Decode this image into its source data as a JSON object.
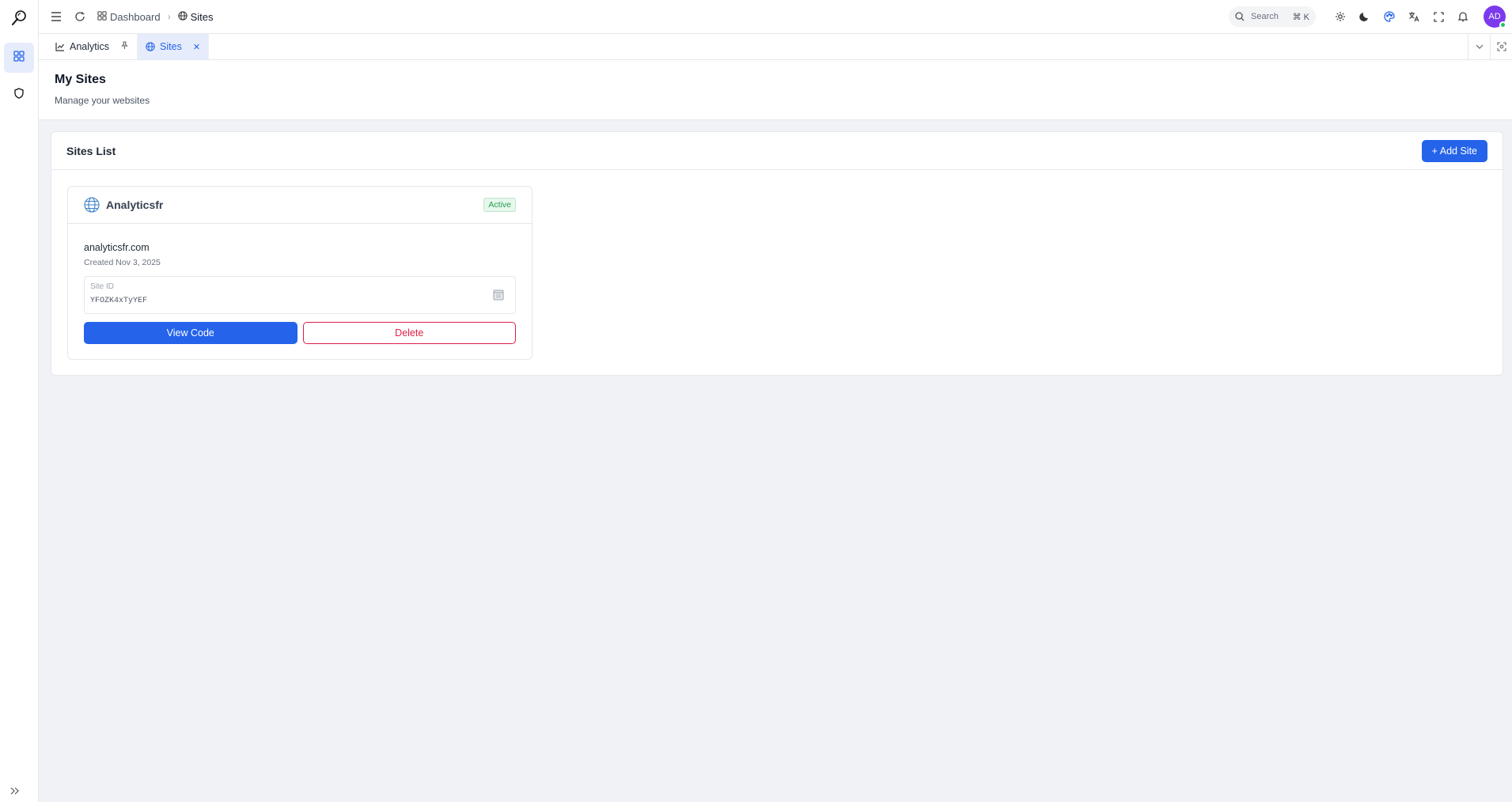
{
  "header": {
    "breadcrumb": [
      {
        "label": "Dashboard",
        "icon": "dashboard-grid-icon"
      },
      {
        "label": "Sites",
        "icon": "globe-icon"
      }
    ],
    "search": {
      "placeholder": "Search",
      "shortcut": "⌘ K"
    },
    "avatar_initials": "AD",
    "icons": [
      "menu-icon",
      "refresh-icon",
      "settings-icon",
      "dark-mode-icon",
      "theme-palette-icon",
      "translate-icon",
      "fullscreen-icon",
      "notification-bell-icon"
    ]
  },
  "sidebar": {
    "items": [
      {
        "name": "dashboard",
        "icon": "dashboard-grid-icon",
        "active": true
      },
      {
        "name": "security",
        "icon": "shield-icon",
        "active": false
      }
    ]
  },
  "tabs": [
    {
      "label": "Analytics",
      "icon": "chart-icon",
      "action": "pin-icon",
      "active": false
    },
    {
      "label": "Sites",
      "icon": "globe-icon",
      "action": "close-icon",
      "active": true
    }
  ],
  "page": {
    "title": "My Sites",
    "subtitle": "Manage your websites"
  },
  "panel": {
    "title": "Sites List",
    "add_label": "+ Add Site"
  },
  "sites": [
    {
      "name": "Analyticsfr",
      "status": "Active",
      "domain": "analyticsfr.com",
      "created": "Created Nov 3, 2025",
      "id_label": "Site ID",
      "id_value": "YFOZK4xTyYEF",
      "view_label": "View Code",
      "delete_label": "Delete"
    }
  ],
  "colors": {
    "accent": "#2563eb",
    "danger": "#e11d48",
    "success": "#22a052",
    "avatar": "#7c3aed"
  }
}
